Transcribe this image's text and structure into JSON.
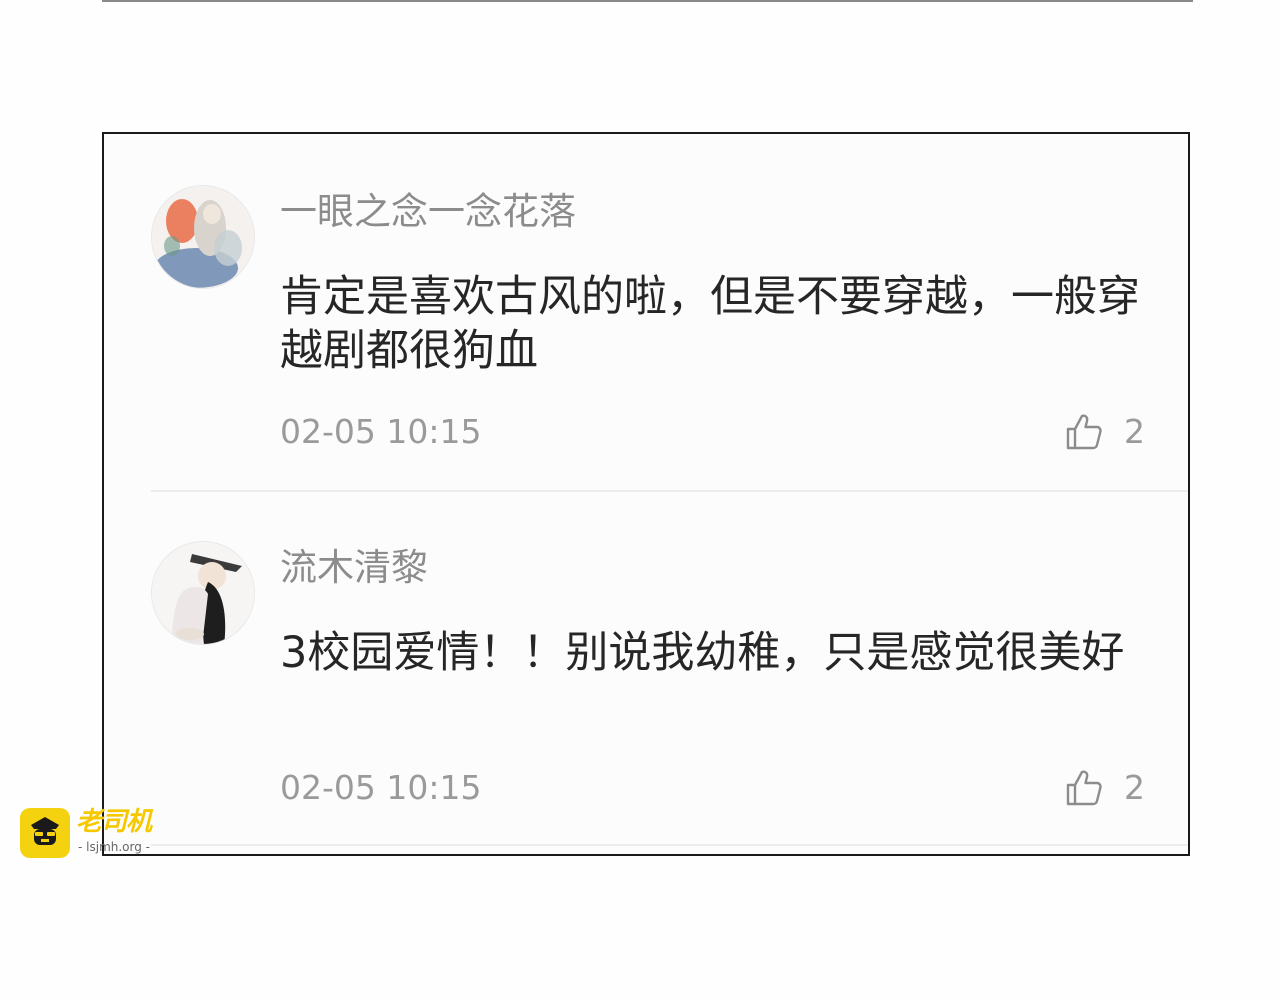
{
  "comments": [
    {
      "username": "一眼之念一念花落",
      "text": "肯定是喜欢古风的啦，但是不要穿越，一般穿越剧都很狗血",
      "timestamp": "02-05 10:15",
      "likes": "2",
      "avatar_icon": "watercolor-portrait-avatar"
    },
    {
      "username": "流木清黎",
      "text": "3校园爱情！！别说我幼稚，只是感觉很美好",
      "timestamp": "02-05 10:15",
      "likes": "2",
      "avatar_icon": "boy-with-hat-avatar"
    }
  ],
  "watermark": {
    "name": "老司机",
    "url": "- lsjmh.org -",
    "logo_icon": "driver-mascot-icon"
  },
  "colors": {
    "username": "#8c8c8c",
    "body_text": "#262626",
    "meta": "#9a9a9a",
    "watermark": "#f5c800"
  }
}
